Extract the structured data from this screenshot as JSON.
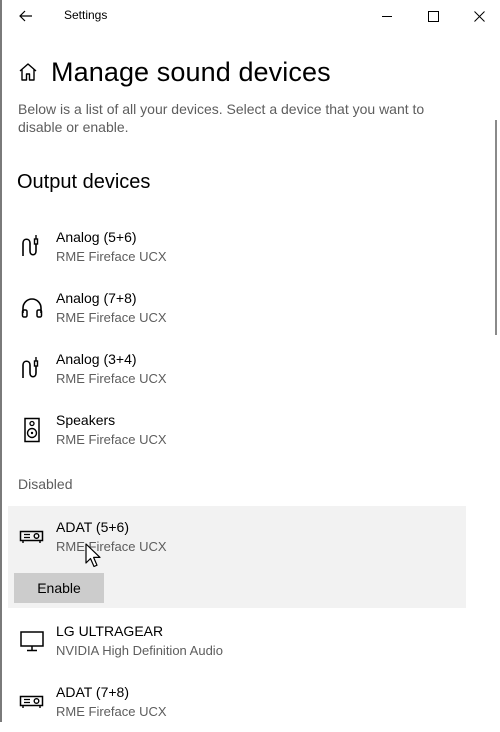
{
  "window": {
    "title": "Settings",
    "controls": [
      "back-icon",
      "minimize-icon",
      "maximize-icon",
      "close-icon"
    ]
  },
  "page": {
    "title": "Manage sound devices",
    "description": "Below is a list of all your devices. Select a device that you want to disable or enable."
  },
  "output_section": {
    "title": "Output devices",
    "devices": [
      {
        "name": "Analog (5+6)",
        "subtitle": "RME Fireface UCX",
        "icon": "line-out-icon"
      },
      {
        "name": "Analog (7+8)",
        "subtitle": "RME Fireface UCX",
        "icon": "headphones-icon"
      },
      {
        "name": "Analog (3+4)",
        "subtitle": "RME Fireface UCX",
        "icon": "line-out-icon"
      },
      {
        "name": "Speakers",
        "subtitle": "RME Fireface UCX",
        "icon": "speaker-icon"
      }
    ]
  },
  "disabled_section": {
    "label": "Disabled",
    "devices": [
      {
        "name": "ADAT (5+6)",
        "subtitle": "RME Fireface UCX",
        "icon": "projector-icon",
        "selected": true,
        "action_label": "Enable"
      },
      {
        "name": "LG ULTRAGEAR",
        "subtitle": "NVIDIA High Definition Audio",
        "icon": "monitor-icon"
      },
      {
        "name": "ADAT (7+8)",
        "subtitle": "RME Fireface UCX",
        "icon": "projector-icon"
      }
    ]
  },
  "colors": {
    "selected_background": "#f2f2f2",
    "button_background": "#cccccc",
    "secondary_text": "#5d5d5d"
  }
}
